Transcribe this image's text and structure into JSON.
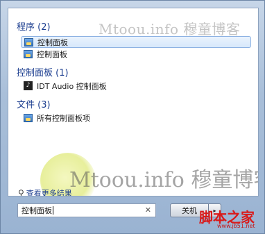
{
  "groups": {
    "programs": {
      "title": "程序 (2)"
    },
    "control_panel": {
      "title": "控制面板 (1)"
    },
    "files": {
      "title": "文件 (3)"
    }
  },
  "items": {
    "program1": "控制面板",
    "program2": "控制面板",
    "cp_item": "IDT Audio 控制面板",
    "file_item": "所有控制面板项"
  },
  "see_more": "查看更多结果",
  "search": {
    "value": "控制面板",
    "clear_icon": "x-clear-icon"
  },
  "shutdown": {
    "label": "关机",
    "arrow": "▸"
  },
  "watermark": {
    "top": "Mtoou.info 穆童博客",
    "big": "Mtoou.info 穆童博客"
  },
  "site": {
    "logo": "脚本之家",
    "url": "www.jb51.net"
  },
  "colors": {
    "group_header": "#1b3d8f",
    "selection": "#d7e8fb",
    "frame": "#a9bfd9"
  }
}
